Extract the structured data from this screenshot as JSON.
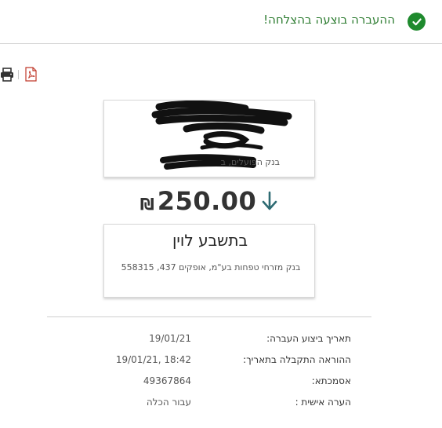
{
  "status": {
    "message": "ההעברה בוצעה בהצלחה!",
    "color": "#1f8a2e"
  },
  "toolbar": {
    "print_icon": "print-icon",
    "pdf_icon": "pdf-icon"
  },
  "from_account": {
    "bank": "בנק הפועלים, ב"
  },
  "transfer": {
    "currency": "₪",
    "amount": "250.00",
    "direction_icon": "arrow-down-icon",
    "accent": "#2e6b73"
  },
  "to_account": {
    "name": "בתשבע לוין",
    "address": "בנק מזרחי טפחות בע\"מ, אופקים 437, 558315"
  },
  "details": [
    {
      "label": "תאריך ביצוע העברה:",
      "value": "19/01/21"
    },
    {
      "label": "ההוראה התקבלה בתאריך:",
      "value": "18:42 ,19/01/21"
    },
    {
      "label": "אסמכתא:",
      "value": "49367864"
    },
    {
      "label": "הערה אישית :",
      "value": "עבור הכלה"
    }
  ]
}
